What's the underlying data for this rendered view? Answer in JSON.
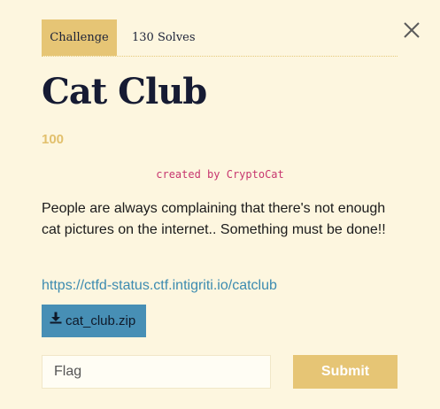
{
  "tabs": {
    "challenge_label": "Challenge",
    "solves_label": "130 Solves"
  },
  "challenge": {
    "name": "Cat Club",
    "points": "100",
    "author": "created by CryptoCat",
    "description": "People are always complaining that there's not enough cat pictures on the internet.. Something must be done!!",
    "link": "https://ctfd-status.ctf.intigriti.io/catclub",
    "file_name": "cat_club.zip"
  },
  "form": {
    "flag_placeholder": "Flag",
    "flag_value": "",
    "submit_label": "Submit"
  },
  "icons": {
    "close": "close-icon",
    "download": "download-icon"
  },
  "colors": {
    "background": "#fdf6df",
    "accent": "#e6c575",
    "points": "#e2c06d",
    "author": "#c7366f",
    "link": "#3c8bb0",
    "file_button": "#478fb5"
  }
}
